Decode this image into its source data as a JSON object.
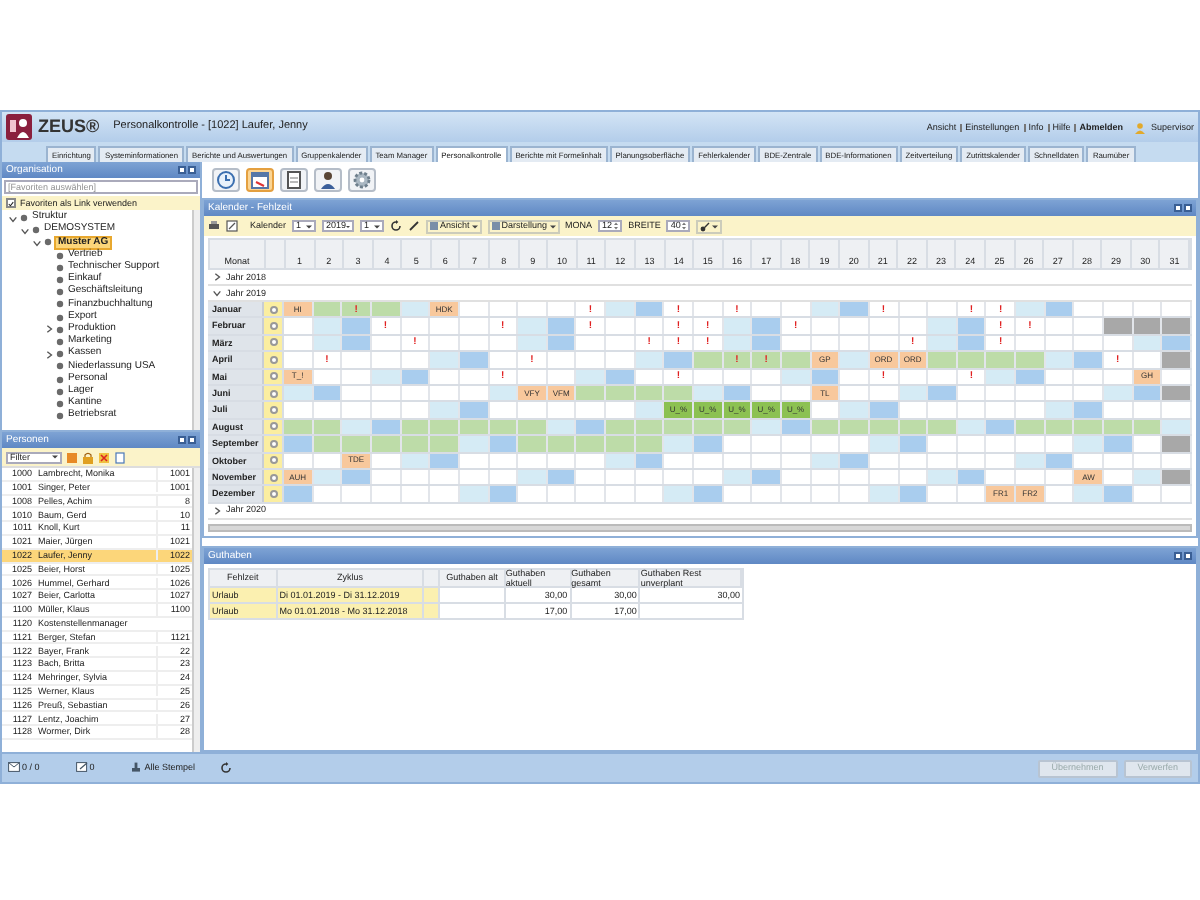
{
  "app": {
    "logo": "ZEUS®",
    "title": "Personalkontrolle - [1022] Laufer, Jenny"
  },
  "top_links": [
    "Ansicht",
    "Einstellungen",
    "Info",
    "Hilfe",
    "Abmelden"
  ],
  "user": "Supervisor",
  "tabs": [
    {
      "label": "Einrichtung",
      "selected": false
    },
    {
      "label": "Systeminformationen",
      "selected": false
    },
    {
      "label": "Berichte und Auswertungen",
      "selected": false
    },
    {
      "label": "Gruppenkalender",
      "selected": false
    },
    {
      "label": "Team Manager",
      "selected": false
    },
    {
      "label": "Personalkontrolle",
      "selected": true
    },
    {
      "label": "Berichte mit Formelinhalt",
      "selected": false
    },
    {
      "label": "Planungsoberfläche",
      "selected": false
    },
    {
      "label": "Fehlerkalender",
      "selected": false
    },
    {
      "label": "BDE-Zentrale",
      "selected": false
    },
    {
      "label": "BDE-Informationen",
      "selected": false
    },
    {
      "label": "Zeitverteilung",
      "selected": false
    },
    {
      "label": "Zutrittskalender",
      "selected": false
    },
    {
      "label": "Schnelldaten",
      "selected": false
    },
    {
      "label": "Raumüber",
      "selected": false
    }
  ],
  "organisation": {
    "title": "Organisation",
    "search": {
      "placeholder": "[Favoriten auswählen]"
    },
    "favorites_as_link": {
      "label": "Favoriten als Link verwenden",
      "checked": true
    },
    "tree": [
      {
        "label": "Struktur",
        "expanded": true,
        "selected": false,
        "children": [
          {
            "label": "DEMOSYSTEM",
            "expanded": true,
            "selected": false,
            "children": [
              {
                "label": "Muster AG",
                "expanded": true,
                "selected": true,
                "children": [
                  {
                    "label": "Vertrieb",
                    "selected": false
                  },
                  {
                    "label": "Technischer Support",
                    "selected": false
                  },
                  {
                    "label": "Einkauf",
                    "selected": false
                  },
                  {
                    "label": "Geschäftsleitung",
                    "selected": false
                  },
                  {
                    "label": "Finanzbuchhaltung",
                    "selected": false
                  },
                  {
                    "label": "Export",
                    "selected": false
                  },
                  {
                    "label": "Produktion",
                    "expanded": false,
                    "selected": false
                  },
                  {
                    "label": "Marketing",
                    "selected": false
                  },
                  {
                    "label": "Kassen",
                    "expanded": false,
                    "selected": false
                  },
                  {
                    "label": "Niederlassung USA",
                    "selected": false
                  },
                  {
                    "label": "Personal",
                    "selected": false
                  },
                  {
                    "label": "Lager",
                    "selected": false
                  },
                  {
                    "label": "Kantine",
                    "selected": false
                  },
                  {
                    "label": "Betriebsrat",
                    "selected": false
                  }
                ]
              }
            ]
          }
        ]
      }
    ]
  },
  "personen": {
    "title": "Personen",
    "filter": "Filter",
    "rows": [
      {
        "nr": "1000",
        "name": "Lambrecht, Monika",
        "code": "1001",
        "selected": false
      },
      {
        "nr": "1001",
        "name": "Singer, Peter",
        "code": "1001",
        "selected": false
      },
      {
        "nr": "1008",
        "name": "Pelles, Achim",
        "code": "8",
        "selected": false
      },
      {
        "nr": "1010",
        "name": "Baum, Gerd",
        "code": "10",
        "selected": false
      },
      {
        "nr": "1011",
        "name": "Knoll, Kurt",
        "code": "11",
        "selected": false
      },
      {
        "nr": "1021",
        "name": "Maier, Jürgen",
        "code": "1021",
        "selected": false
      },
      {
        "nr": "1022",
        "name": "Laufer, Jenny",
        "code": "1022",
        "selected": true
      },
      {
        "nr": "1025",
        "name": "Beier, Horst",
        "code": "1025",
        "selected": false
      },
      {
        "nr": "1026",
        "name": "Hummel, Gerhard",
        "code": "1026",
        "selected": false
      },
      {
        "nr": "1027",
        "name": "Beier, Carlotta",
        "code": "1027",
        "selected": false
      },
      {
        "nr": "1100",
        "name": "Müller, Klaus",
        "code": "1100",
        "selected": false
      },
      {
        "nr": "1120",
        "name": "Kostenstellenmanager",
        "code": "",
        "selected": false
      },
      {
        "nr": "1121",
        "name": "Berger, Stefan",
        "code": "1121",
        "selected": false
      },
      {
        "nr": "1122",
        "name": "Bayer, Frank",
        "code": "22",
        "selected": false
      },
      {
        "nr": "1123",
        "name": "Bach, Britta",
        "code": "23",
        "selected": false
      },
      {
        "nr": "1124",
        "name": "Mehringer, Sylvia",
        "code": "24",
        "selected": false
      },
      {
        "nr": "1125",
        "name": "Werner, Klaus",
        "code": "25",
        "selected": false
      },
      {
        "nr": "1126",
        "name": "Preuß, Sebastian",
        "code": "26",
        "selected": false
      },
      {
        "nr": "1127",
        "name": "Lentz, Joachim",
        "code": "27",
        "selected": false
      },
      {
        "nr": "1128",
        "name": "Wormer, Dirk",
        "code": "28",
        "selected": false
      }
    ]
  },
  "toolbar": [
    {
      "kind": "clock",
      "selected": false
    },
    {
      "kind": "calendar",
      "selected": true
    },
    {
      "kind": "document",
      "selected": false
    },
    {
      "kind": "person",
      "selected": false
    },
    {
      "kind": "gear",
      "selected": false
    }
  ],
  "calendar": {
    "title": "Kalender - Fehlzeit",
    "kalender_label": "Kalender",
    "kalender_value": "1",
    "year": "2019",
    "month": "1",
    "ansicht": "Ansicht",
    "darstellung": "Darstellung",
    "mona_label": "MONA",
    "mona_value": "12",
    "breite_label": "BREITE",
    "breite_value": "40",
    "month_header": "Monat",
    "days": [
      "1",
      "2",
      "3",
      "4",
      "5",
      "6",
      "7",
      "8",
      "9",
      "10",
      "11",
      "12",
      "13",
      "14",
      "15",
      "16",
      "17",
      "18",
      "19",
      "20",
      "21",
      "22",
      "23",
      "24",
      "25",
      "26",
      "27",
      "28",
      "29",
      "30",
      "31"
    ],
    "years": [
      {
        "label": "Jahr 2018",
        "expanded": false
      },
      {
        "label": "Jahr 2019",
        "expanded": true,
        "months": [
          {
            "name": "Januar",
            "days": [
              {
                "color": "#f8c89c",
                "text": "HI"
              },
              {
                "color": "#bddca8"
              },
              {
                "color": "#bddca8",
                "text": "!"
              },
              {
                "color": "#bddca8"
              },
              {
                "color": "#d5ebf5"
              },
              {
                "color": "#f8c89c",
                "text": "HDK"
              },
              {
                "color": "#ffffff"
              },
              {
                "color": "#ffffff"
              },
              {
                "color": "#ffffff"
              },
              {
                "color": "#ffffff"
              },
              {
                "color": "#ffffff",
                "text": "!"
              },
              {
                "color": "#d5ebf5"
              },
              {
                "color": "#a9cdee"
              },
              {
                "color": "#ffffff",
                "text": "!"
              },
              {
                "color": "#ffffff"
              },
              {
                "color": "#ffffff",
                "text": "!"
              },
              {
                "color": "#ffffff"
              },
              {
                "color": "#ffffff"
              },
              {
                "color": "#d5ebf5"
              },
              {
                "color": "#a9cdee"
              },
              {
                "color": "#ffffff",
                "text": "!"
              },
              {
                "color": "#ffffff"
              },
              {
                "color": "#ffffff"
              },
              {
                "color": "#ffffff",
                "text": "!"
              },
              {
                "color": "#ffffff",
                "text": "!"
              },
              {
                "color": "#d5ebf5"
              },
              {
                "color": "#a9cdee"
              },
              {
                "color": "#ffffff"
              },
              {
                "color": "#ffffff"
              },
              {
                "color": "#ffffff"
              },
              {
                "color": "#ffffff"
              }
            ]
          },
          {
            "name": "Februar",
            "days": [
              {
                "color": "#ffffff"
              },
              {
                "color": "#d5ebf5"
              },
              {
                "color": "#a9cdee"
              },
              {
                "color": "#ffffff",
                "text": "!"
              },
              {
                "color": "#ffffff"
              },
              {
                "color": "#ffffff"
              },
              {
                "color": "#ffffff"
              },
              {
                "color": "#ffffff",
                "text": "!"
              },
              {
                "color": "#d5ebf5"
              },
              {
                "color": "#a9cdee"
              },
              {
                "color": "#ffffff",
                "text": "!"
              },
              {
                "color": "#ffffff"
              },
              {
                "color": "#ffffff"
              },
              {
                "color": "#ffffff",
                "text": "!"
              },
              {
                "color": "#ffffff",
                "text": "!"
              },
              {
                "color": "#d5ebf5"
              },
              {
                "color": "#a9cdee"
              },
              {
                "color": "#ffffff",
                "text": "!"
              },
              {
                "color": "#ffffff"
              },
              {
                "color": "#ffffff"
              },
              {
                "color": "#ffffff"
              },
              {
                "color": "#ffffff"
              },
              {
                "color": "#d5ebf5"
              },
              {
                "color": "#a9cdee"
              },
              {
                "color": "#ffffff",
                "text": "!"
              },
              {
                "color": "#ffffff",
                "text": "!"
              },
              {
                "color": "#ffffff"
              },
              {
                "color": "#ffffff"
              },
              {
                "color": "#a8a8a8"
              },
              {
                "color": "#a8a8a8"
              },
              {
                "color": "#a8a8a8"
              }
            ]
          },
          {
            "name": "März",
            "days": [
              {
                "color": "#ffffff"
              },
              {
                "color": "#d5ebf5"
              },
              {
                "color": "#a9cdee"
              },
              {
                "color": "#ffffff"
              },
              {
                "color": "#ffffff",
                "text": "!"
              },
              {
                "color": "#ffffff"
              },
              {
                "color": "#ffffff"
              },
              {
                "color": "#ffffff"
              },
              {
                "color": "#d5ebf5"
              },
              {
                "color": "#a9cdee"
              },
              {
                "color": "#ffffff"
              },
              {
                "color": "#ffffff"
              },
              {
                "color": "#ffffff",
                "text": "!"
              },
              {
                "color": "#ffffff",
                "text": "!"
              },
              {
                "color": "#ffffff",
                "text": "!"
              },
              {
                "color": "#d5ebf5"
              },
              {
                "color": "#a9cdee"
              },
              {
                "color": "#ffffff"
              },
              {
                "color": "#ffffff"
              },
              {
                "color": "#ffffff"
              },
              {
                "color": "#ffffff"
              },
              {
                "color": "#ffffff",
                "text": "!"
              },
              {
                "color": "#d5ebf5"
              },
              {
                "color": "#a9cdee"
              },
              {
                "color": "#ffffff",
                "text": "!"
              },
              {
                "color": "#ffffff"
              },
              {
                "color": "#ffffff"
              },
              {
                "color": "#ffffff"
              },
              {
                "color": "#ffffff"
              },
              {
                "color": "#d5ebf5"
              },
              {
                "color": "#a9cdee"
              }
            ]
          },
          {
            "name": "April",
            "days": [
              {
                "color": "#ffffff"
              },
              {
                "color": "#ffffff",
                "text": "!"
              },
              {
                "color": "#ffffff"
              },
              {
                "color": "#ffffff"
              },
              {
                "color": "#ffffff"
              },
              {
                "color": "#d5ebf5"
              },
              {
                "color": "#a9cdee"
              },
              {
                "color": "#ffffff"
              },
              {
                "color": "#ffffff",
                "text": "!"
              },
              {
                "color": "#ffffff"
              },
              {
                "color": "#ffffff"
              },
              {
                "color": "#ffffff"
              },
              {
                "color": "#d5ebf5"
              },
              {
                "color": "#a9cdee"
              },
              {
                "color": "#bddca8"
              },
              {
                "color": "#bddca8",
                "text": "!"
              },
              {
                "color": "#bddca8",
                "text": "!"
              },
              {
                "color": "#bddca8"
              },
              {
                "color": "#f8c89c",
                "text": "GP"
              },
              {
                "color": "#d5ebf5"
              },
              {
                "color": "#f8c89c",
                "text": "ORD"
              },
              {
                "color": "#f8c89c",
                "text": "ORD"
              },
              {
                "color": "#bddca8"
              },
              {
                "color": "#bddca8"
              },
              {
                "color": "#bddca8"
              },
              {
                "color": "#bddca8"
              },
              {
                "color": "#d5ebf5"
              },
              {
                "color": "#a9cdee"
              },
              {
                "color": "#ffffff",
                "text": "!"
              },
              {
                "color": "#ffffff"
              },
              {
                "color": "#a8a8a8"
              }
            ]
          },
          {
            "name": "Mai",
            "days": [
              {
                "color": "#f8c89c",
                "text": "T_!"
              },
              {
                "color": "#ffffff"
              },
              {
                "color": "#ffffff"
              },
              {
                "color": "#d5ebf5"
              },
              {
                "color": "#a9cdee"
              },
              {
                "color": "#ffffff"
              },
              {
                "color": "#ffffff"
              },
              {
                "color": "#ffffff",
                "text": "!"
              },
              {
                "color": "#ffffff"
              },
              {
                "color": "#ffffff"
              },
              {
                "color": "#d5ebf5"
              },
              {
                "color": "#a9cdee"
              },
              {
                "color": "#ffffff"
              },
              {
                "color": "#ffffff",
                "text": "!"
              },
              {
                "color": "#ffffff"
              },
              {
                "color": "#ffffff"
              },
              {
                "color": "#ffffff"
              },
              {
                "color": "#d5ebf5"
              },
              {
                "color": "#a9cdee"
              },
              {
                "color": "#ffffff"
              },
              {
                "color": "#ffffff",
                "text": "!"
              },
              {
                "color": "#ffffff"
              },
              {
                "color": "#ffffff"
              },
              {
                "color": "#ffffff",
                "text": "!"
              },
              {
                "color": "#d5ebf5"
              },
              {
                "color": "#a9cdee"
              },
              {
                "color": "#ffffff"
              },
              {
                "color": "#ffffff"
              },
              {
                "color": "#ffffff"
              },
              {
                "color": "#f8c89c",
                "text": "GH"
              },
              {
                "color": "#ffffff"
              }
            ]
          },
          {
            "name": "Juni",
            "days": [
              {
                "color": "#d5ebf5"
              },
              {
                "color": "#a9cdee"
              },
              {
                "color": "#ffffff"
              },
              {
                "color": "#ffffff"
              },
              {
                "color": "#ffffff"
              },
              {
                "color": "#ffffff"
              },
              {
                "color": "#ffffff"
              },
              {
                "color": "#d5ebf5"
              },
              {
                "color": "#f8c89c",
                "text": "VFY"
              },
              {
                "color": "#f8c89c",
                "text": "VFM"
              },
              {
                "color": "#bddca8"
              },
              {
                "color": "#bddca8"
              },
              {
                "color": "#bddca8"
              },
              {
                "color": "#bddca8"
              },
              {
                "color": "#d5ebf5"
              },
              {
                "color": "#a9cdee"
              },
              {
                "color": "#ffffff"
              },
              {
                "color": "#ffffff"
              },
              {
                "color": "#f8c89c",
                "text": "TL"
              },
              {
                "color": "#ffffff"
              },
              {
                "color": "#ffffff"
              },
              {
                "color": "#d5ebf5"
              },
              {
                "color": "#a9cdee"
              },
              {
                "color": "#ffffff"
              },
              {
                "color": "#ffffff"
              },
              {
                "color": "#ffffff"
              },
              {
                "color": "#ffffff"
              },
              {
                "color": "#ffffff"
              },
              {
                "color": "#d5ebf5"
              },
              {
                "color": "#a9cdee"
              },
              {
                "color": "#a8a8a8"
              }
            ]
          },
          {
            "name": "Juli",
            "days": [
              {
                "color": "#ffffff"
              },
              {
                "color": "#ffffff"
              },
              {
                "color": "#ffffff"
              },
              {
                "color": "#ffffff"
              },
              {
                "color": "#ffffff"
              },
              {
                "color": "#d5ebf5"
              },
              {
                "color": "#a9cdee"
              },
              {
                "color": "#ffffff"
              },
              {
                "color": "#ffffff"
              },
              {
                "color": "#ffffff"
              },
              {
                "color": "#ffffff"
              },
              {
                "color": "#ffffff"
              },
              {
                "color": "#d5ebf5"
              },
              {
                "color": "#8cc152",
                "text": "U_%"
              },
              {
                "color": "#8cc152",
                "text": "U_%"
              },
              {
                "color": "#8cc152",
                "text": "U_%"
              },
              {
                "color": "#8cc152",
                "text": "U_%"
              },
              {
                "color": "#8cc152",
                "text": "U_%"
              },
              {
                "color": "#ffffff"
              },
              {
                "color": "#d5ebf5"
              },
              {
                "color": "#a9cdee"
              },
              {
                "color": "#ffffff"
              },
              {
                "color": "#ffffff"
              },
              {
                "color": "#ffffff"
              },
              {
                "color": "#ffffff"
              },
              {
                "color": "#ffffff"
              },
              {
                "color": "#d5ebf5"
              },
              {
                "color": "#a9cdee"
              },
              {
                "color": "#ffffff"
              },
              {
                "color": "#ffffff"
              },
              {
                "color": "#ffffff"
              }
            ]
          },
          {
            "name": "August",
            "days": [
              {
                "color": "#bddca8"
              },
              {
                "color": "#bddca8"
              },
              {
                "color": "#d5ebf5"
              },
              {
                "color": "#a9cdee"
              },
              {
                "color": "#bddca8"
              },
              {
                "color": "#bddca8"
              },
              {
                "color": "#bddca8"
              },
              {
                "color": "#bddca8"
              },
              {
                "color": "#bddca8"
              },
              {
                "color": "#d5ebf5"
              },
              {
                "color": "#a9cdee"
              },
              {
                "color": "#bddca8"
              },
              {
                "color": "#bddca8"
              },
              {
                "color": "#bddca8"
              },
              {
                "color": "#bddca8"
              },
              {
                "color": "#bddca8"
              },
              {
                "color": "#d5ebf5"
              },
              {
                "color": "#a9cdee"
              },
              {
                "color": "#bddca8"
              },
              {
                "color": "#bddca8"
              },
              {
                "color": "#bddca8"
              },
              {
                "color": "#bddca8"
              },
              {
                "color": "#bddca8"
              },
              {
                "color": "#d5ebf5"
              },
              {
                "color": "#a9cdee"
              },
              {
                "color": "#bddca8"
              },
              {
                "color": "#bddca8"
              },
              {
                "color": "#bddca8"
              },
              {
                "color": "#bddca8"
              },
              {
                "color": "#bddca8"
              },
              {
                "color": "#d5ebf5"
              }
            ]
          },
          {
            "name": "September",
            "days": [
              {
                "color": "#a9cdee"
              },
              {
                "color": "#bddca8"
              },
              {
                "color": "#bddca8"
              },
              {
                "color": "#bddca8"
              },
              {
                "color": "#bddca8"
              },
              {
                "color": "#bddca8"
              },
              {
                "color": "#d5ebf5"
              },
              {
                "color": "#a9cdee"
              },
              {
                "color": "#bddca8"
              },
              {
                "color": "#bddca8"
              },
              {
                "color": "#bddca8"
              },
              {
                "color": "#bddca8"
              },
              {
                "color": "#bddca8"
              },
              {
                "color": "#d5ebf5"
              },
              {
                "color": "#a9cdee"
              },
              {
                "color": "#ffffff"
              },
              {
                "color": "#ffffff"
              },
              {
                "color": "#ffffff"
              },
              {
                "color": "#ffffff"
              },
              {
                "color": "#ffffff"
              },
              {
                "color": "#d5ebf5"
              },
              {
                "color": "#a9cdee"
              },
              {
                "color": "#ffffff"
              },
              {
                "color": "#ffffff"
              },
              {
                "color": "#ffffff"
              },
              {
                "color": "#ffffff"
              },
              {
                "color": "#ffffff"
              },
              {
                "color": "#d5ebf5"
              },
              {
                "color": "#a9cdee"
              },
              {
                "color": "#ffffff"
              },
              {
                "color": "#a8a8a8"
              }
            ]
          },
          {
            "name": "Oktober",
            "days": [
              {
                "color": "#ffffff"
              },
              {
                "color": "#ffffff"
              },
              {
                "color": "#f8c89c",
                "text": "TDE"
              },
              {
                "color": "#ffffff"
              },
              {
                "color": "#d5ebf5"
              },
              {
                "color": "#a9cdee"
              },
              {
                "color": "#ffffff"
              },
              {
                "color": "#ffffff"
              },
              {
                "color": "#ffffff"
              },
              {
                "color": "#ffffff"
              },
              {
                "color": "#ffffff"
              },
              {
                "color": "#d5ebf5"
              },
              {
                "color": "#a9cdee"
              },
              {
                "color": "#ffffff"
              },
              {
                "color": "#ffffff"
              },
              {
                "color": "#ffffff"
              },
              {
                "color": "#ffffff"
              },
              {
                "color": "#ffffff"
              },
              {
                "color": "#d5ebf5"
              },
              {
                "color": "#a9cdee"
              },
              {
                "color": "#ffffff"
              },
              {
                "color": "#ffffff"
              },
              {
                "color": "#ffffff"
              },
              {
                "color": "#ffffff"
              },
              {
                "color": "#ffffff"
              },
              {
                "color": "#d5ebf5"
              },
              {
                "color": "#a9cdee"
              },
              {
                "color": "#ffffff"
              },
              {
                "color": "#ffffff"
              },
              {
                "color": "#ffffff"
              },
              {
                "color": "#ffffff"
              }
            ]
          },
          {
            "name": "November",
            "days": [
              {
                "color": "#f8c89c",
                "text": "AUH"
              },
              {
                "color": "#d5ebf5"
              },
              {
                "color": "#a9cdee"
              },
              {
                "color": "#ffffff"
              },
              {
                "color": "#ffffff"
              },
              {
                "color": "#ffffff"
              },
              {
                "color": "#ffffff"
              },
              {
                "color": "#ffffff"
              },
              {
                "color": "#d5ebf5"
              },
              {
                "color": "#a9cdee"
              },
              {
                "color": "#ffffff"
              },
              {
                "color": "#ffffff"
              },
              {
                "color": "#ffffff"
              },
              {
                "color": "#ffffff"
              },
              {
                "color": "#ffffff"
              },
              {
                "color": "#d5ebf5"
              },
              {
                "color": "#a9cdee"
              },
              {
                "color": "#ffffff"
              },
              {
                "color": "#ffffff"
              },
              {
                "color": "#ffffff"
              },
              {
                "color": "#ffffff"
              },
              {
                "color": "#ffffff"
              },
              {
                "color": "#d5ebf5"
              },
              {
                "color": "#a9cdee"
              },
              {
                "color": "#ffffff"
              },
              {
                "color": "#ffffff"
              },
              {
                "color": "#ffffff"
              },
              {
                "color": "#f8c89c",
                "text": "AW"
              },
              {
                "color": "#ffffff"
              },
              {
                "color": "#d5ebf5"
              },
              {
                "color": "#a8a8a8"
              }
            ]
          },
          {
            "name": "Dezember",
            "days": [
              {
                "color": "#a9cdee"
              },
              {
                "color": "#ffffff"
              },
              {
                "color": "#ffffff"
              },
              {
                "color": "#ffffff"
              },
              {
                "color": "#ffffff"
              },
              {
                "color": "#ffffff"
              },
              {
                "color": "#d5ebf5"
              },
              {
                "color": "#a9cdee"
              },
              {
                "color": "#ffffff"
              },
              {
                "color": "#ffffff"
              },
              {
                "color": "#ffffff"
              },
              {
                "color": "#ffffff"
              },
              {
                "color": "#ffffff"
              },
              {
                "color": "#d5ebf5"
              },
              {
                "color": "#a9cdee"
              },
              {
                "color": "#ffffff"
              },
              {
                "color": "#ffffff"
              },
              {
                "color": "#ffffff"
              },
              {
                "color": "#ffffff"
              },
              {
                "color": "#ffffff"
              },
              {
                "color": "#d5ebf5"
              },
              {
                "color": "#a9cdee"
              },
              {
                "color": "#ffffff"
              },
              {
                "color": "#ffffff"
              },
              {
                "color": "#f8c89c",
                "text": "FR1"
              },
              {
                "color": "#f8c89c",
                "text": "FR2"
              },
              {
                "color": "#ffffff"
              },
              {
                "color": "#d5ebf5"
              },
              {
                "color": "#a9cdee"
              },
              {
                "color": "#ffffff"
              },
              {
                "color": "#ffffff"
              }
            ]
          }
        ]
      },
      {
        "label": "Jahr 2020",
        "expanded": false
      }
    ]
  },
  "guthaben": {
    "title": "Guthaben",
    "columns": [
      "Fehlzeit",
      "Zyklus",
      "Guthaben alt",
      "Guthaben aktuell",
      "Guthaben gesamt",
      "Guthaben Rest unverplant"
    ],
    "rows": [
      {
        "fehlzeit": "Urlaub",
        "zyklus": "Di 01.01.2019 - Di 31.12.2019",
        "alt": "",
        "aktuell": "30,00",
        "gesamt": "30,00",
        "rest": "30,00"
      },
      {
        "fehlzeit": "Urlaub",
        "zyklus": "Mo 01.01.2018 - Mo 31.12.2018",
        "alt": "",
        "aktuell": "17,00",
        "gesamt": "17,00",
        "rest": ""
      }
    ]
  },
  "status": {
    "count": "0 / 0",
    "edits": "0",
    "stempel": "Alle Stempel"
  },
  "buttons": [
    {
      "label": "Übernehmen",
      "disabled": true
    },
    {
      "label": "Verwerfen",
      "disabled": true
    }
  ]
}
